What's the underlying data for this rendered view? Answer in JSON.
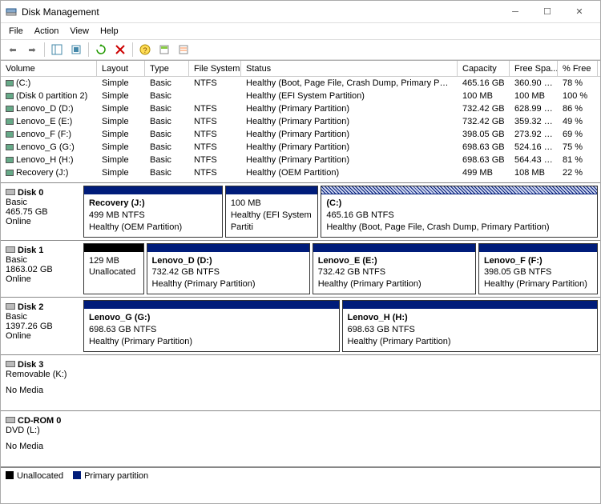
{
  "window": {
    "title": "Disk Management"
  },
  "menu": [
    "File",
    "Action",
    "View",
    "Help"
  ],
  "columns": [
    "Volume",
    "Layout",
    "Type",
    "File System",
    "Status",
    "Capacity",
    "Free Spa...",
    "% Free"
  ],
  "volumes": [
    {
      "name": "(C:)",
      "layout": "Simple",
      "type": "Basic",
      "fs": "NTFS",
      "status": "Healthy (Boot, Page File, Crash Dump, Primary Partition)",
      "capacity": "465.16 GB",
      "free": "360.90 GB",
      "pct": "78 %"
    },
    {
      "name": "(Disk 0 partition 2)",
      "layout": "Simple",
      "type": "Basic",
      "fs": "",
      "status": "Healthy (EFI System Partition)",
      "capacity": "100 MB",
      "free": "100 MB",
      "pct": "100 %"
    },
    {
      "name": "Lenovo_D (D:)",
      "layout": "Simple",
      "type": "Basic",
      "fs": "NTFS",
      "status": "Healthy (Primary Partition)",
      "capacity": "732.42 GB",
      "free": "628.99 GB",
      "pct": "86 %"
    },
    {
      "name": "Lenovo_E (E:)",
      "layout": "Simple",
      "type": "Basic",
      "fs": "NTFS",
      "status": "Healthy (Primary Partition)",
      "capacity": "732.42 GB",
      "free": "359.32 GB",
      "pct": "49 %"
    },
    {
      "name": "Lenovo_F (F:)",
      "layout": "Simple",
      "type": "Basic",
      "fs": "NTFS",
      "status": "Healthy (Primary Partition)",
      "capacity": "398.05 GB",
      "free": "273.92 GB",
      "pct": "69 %"
    },
    {
      "name": "Lenovo_G (G:)",
      "layout": "Simple",
      "type": "Basic",
      "fs": "NTFS",
      "status": "Healthy (Primary Partition)",
      "capacity": "698.63 GB",
      "free": "524.16 GB",
      "pct": "75 %"
    },
    {
      "name": "Lenovo_H (H:)",
      "layout": "Simple",
      "type": "Basic",
      "fs": "NTFS",
      "status": "Healthy (Primary Partition)",
      "capacity": "698.63 GB",
      "free": "564.43 GB",
      "pct": "81 %"
    },
    {
      "name": "Recovery (J:)",
      "layout": "Simple",
      "type": "Basic",
      "fs": "NTFS",
      "status": "Healthy (OEM Partition)",
      "capacity": "499 MB",
      "free": "108 MB",
      "pct": "22 %"
    }
  ],
  "disks": [
    {
      "name": "Disk 0",
      "type": "Basic",
      "size": "465.75 GB",
      "state": "Online",
      "partitions": [
        {
          "title": "Recovery  (J:)",
          "line2": "499 MB NTFS",
          "line3": "Healthy (OEM Partition)",
          "bar": "primary",
          "flex": 18
        },
        {
          "title": "",
          "line2": "100 MB",
          "line3": "Healthy (EFI System Partiti",
          "bar": "primary",
          "flex": 12
        },
        {
          "title": "(C:)",
          "line2": "465.16 GB NTFS",
          "line3": "Healthy (Boot, Page File, Crash Dump, Primary Partition)",
          "bar": "hatch",
          "flex": 36
        }
      ]
    },
    {
      "name": "Disk 1",
      "type": "Basic",
      "size": "1863.02 GB",
      "state": "Online",
      "partitions": [
        {
          "title": "",
          "line2": "129 MB",
          "line3": "Unallocated",
          "bar": "unalloc",
          "flex": 8
        },
        {
          "title": "Lenovo_D  (D:)",
          "line2": "732.42 GB NTFS",
          "line3": "Healthy (Primary Partition)",
          "bar": "primary",
          "flex": 22
        },
        {
          "title": "Lenovo_E  (E:)",
          "line2": "732.42 GB NTFS",
          "line3": "Healthy (Primary Partition)",
          "bar": "primary",
          "flex": 22
        },
        {
          "title": "Lenovo_F  (F:)",
          "line2": "398.05 GB NTFS",
          "line3": "Healthy (Primary Partition)",
          "bar": "primary",
          "flex": 16
        }
      ]
    },
    {
      "name": "Disk 2",
      "type": "Basic",
      "size": "1397.26 GB",
      "state": "Online",
      "partitions": [
        {
          "title": "Lenovo_G  (G:)",
          "line2": "698.63 GB NTFS",
          "line3": "Healthy (Primary Partition)",
          "bar": "primary",
          "flex": 1
        },
        {
          "title": "Lenovo_H  (H:)",
          "line2": "698.63 GB NTFS",
          "line3": "Healthy (Primary Partition)",
          "bar": "primary",
          "flex": 1
        }
      ]
    },
    {
      "name": "Disk 3",
      "type": "Removable (K:)",
      "size": "",
      "state": "No Media",
      "partitions": []
    },
    {
      "name": "CD-ROM 0",
      "type": "DVD (L:)",
      "size": "",
      "state": "No Media",
      "partitions": []
    }
  ],
  "legend": {
    "unalloc": "Unallocated",
    "primary": "Primary partition"
  }
}
